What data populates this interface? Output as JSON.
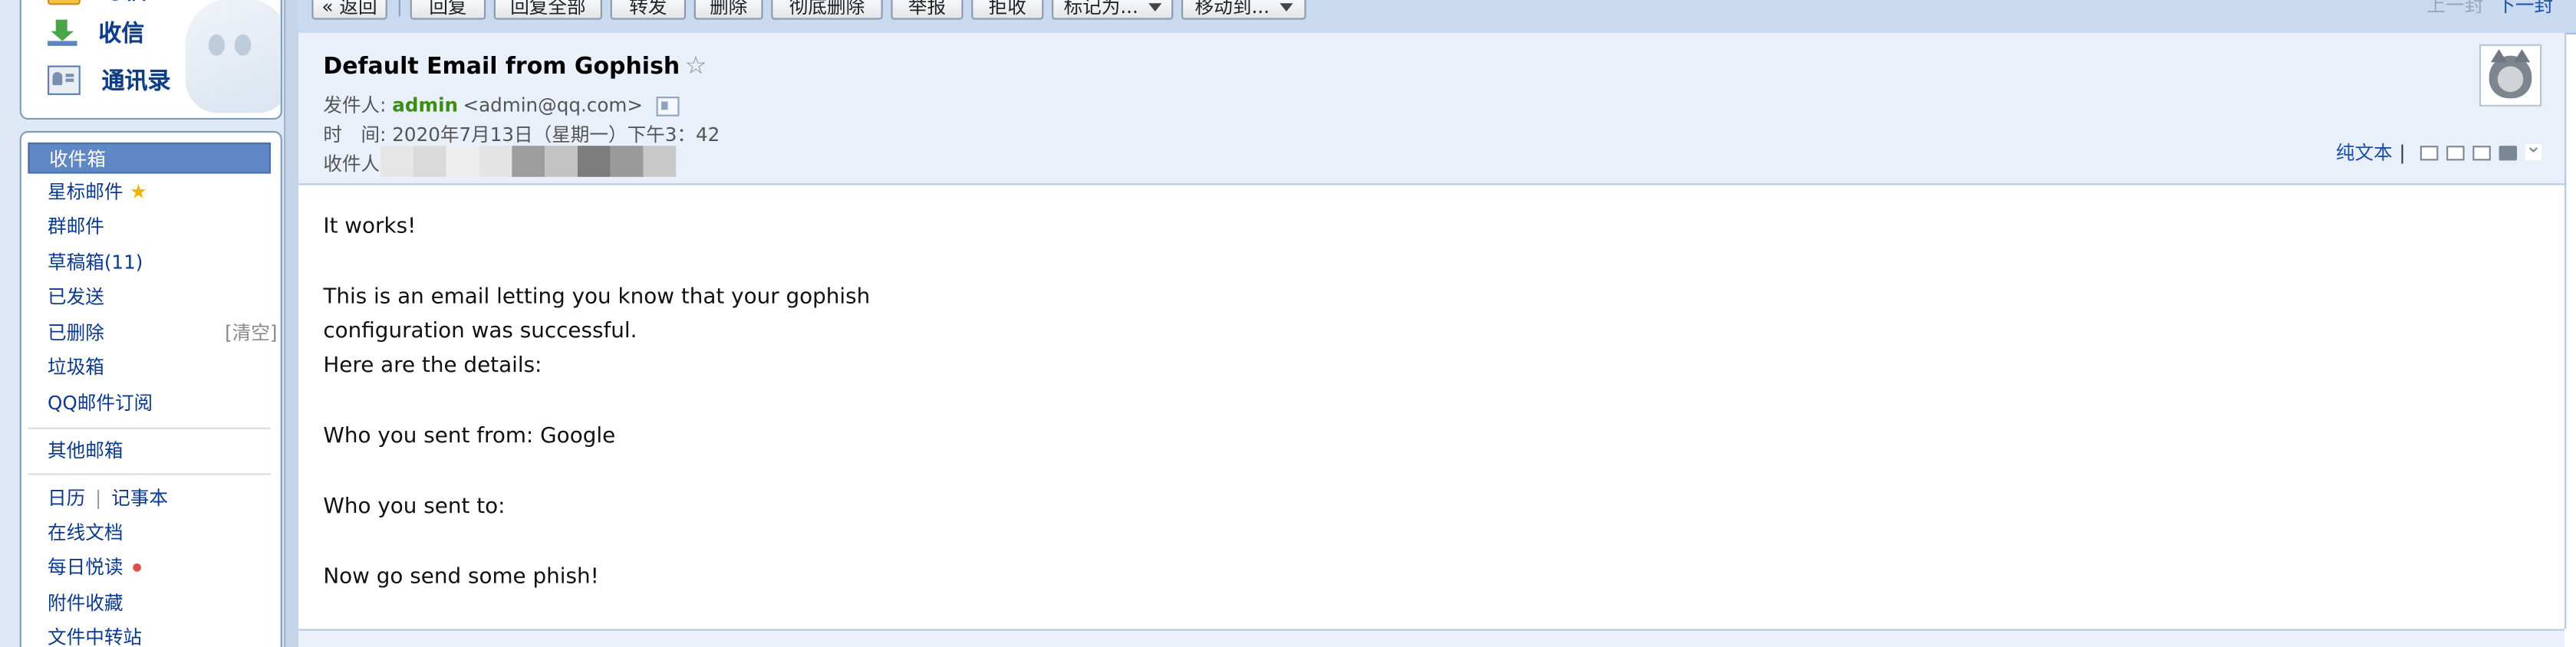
{
  "sidebar": {
    "quick": {
      "write_label": "写信",
      "inbox_label": "收信",
      "contacts_label": "通讯录"
    },
    "folders": [
      {
        "label": "收件箱",
        "active": true
      },
      {
        "label": "星标邮件"
      },
      {
        "label": "群邮件"
      },
      {
        "label": "草稿箱(11)"
      },
      {
        "label": "已发送"
      },
      {
        "label": "已删除",
        "action": "[清空]"
      },
      {
        "label": "垃圾箱"
      },
      {
        "label": "QQ邮件订阅"
      }
    ],
    "other_mailbox": "其他邮箱",
    "calendar": "日历",
    "separator": "|",
    "notes": "记事本",
    "online_docs": "在线文档",
    "daily_reading": "每日悦读",
    "attachments": "附件收藏",
    "file_transfer": "文件中转站"
  },
  "toolbar": {
    "back": "« 返回",
    "reply": "回复",
    "reply_all": "回复全部",
    "forward": "转发",
    "delete": "删除",
    "delete_permanently": "彻底删除",
    "report": "举报",
    "reject": "拒收",
    "mark_as": "标记为...",
    "move_to": "移动到...",
    "prev": "上一封",
    "next": "下一封"
  },
  "message": {
    "subject": "Default Email from Gophish",
    "favorite_icon": "☆",
    "from_label": "发件人:",
    "from_name": "admin",
    "from_address": "<admin@qq.com>",
    "time_label": "时　间:",
    "time_value": "2020年7月13日（星期一）下午3：42",
    "to_label": "收件人:",
    "plain_text": "纯文本",
    "tools_separator": "|",
    "body": [
      "It works!",
      "This is an email letting you know that your gophish",
      "configuration was successful.",
      "Here are the details:",
      "Who you sent from: Google",
      "Who you sent to:",
      "Now go send some phish!"
    ]
  },
  "colors": {
    "sidebar_bg": "#dfe9f5",
    "active_folder": "#5e87c4",
    "link_blue": "#0b3a8c",
    "sender_green": "#3b8d14",
    "header_bg": "#e9f0fa",
    "toolbar_bg": "#c9d9f0"
  }
}
